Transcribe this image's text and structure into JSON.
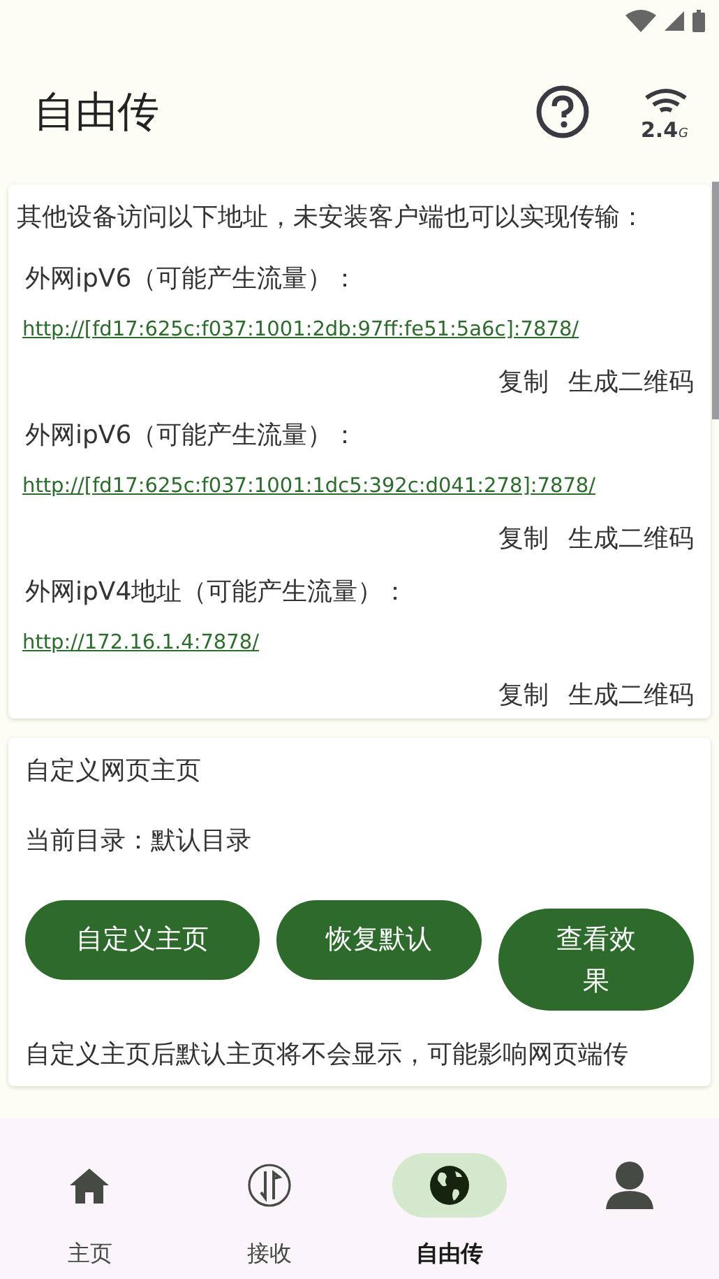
{
  "app_bar": {
    "title": "自由传",
    "band": "2.4",
    "band_unit": "G"
  },
  "address_card": {
    "intro": "其他设备访问以下地址，未安装客户端也可以实现传输：",
    "addresses": [
      {
        "label": "外网ipV6（可能产生流量）：",
        "url": "http://[fd17:625c:f037:1001:2db:97ff:fe51:5a6c]:7878/",
        "actions": [
          "复制",
          "生成二维码"
        ]
      },
      {
        "label": "外网ipV6（可能产生流量）：",
        "url": "http://[fd17:625c:f037:1001:1dc5:392c:d041:278]:7878/",
        "actions": [
          "复制",
          "生成二维码"
        ]
      },
      {
        "label": "外网ipV4地址（可能产生流量）：",
        "url": "http://172.16.1.4:7878/",
        "actions": [
          "复制",
          "生成二维码"
        ]
      }
    ]
  },
  "homepage_card": {
    "title": "自定义网页主页",
    "current_dir": "当前目录：默认目录",
    "buttons": [
      "自定义主页",
      "恢复默认",
      "查看效果"
    ],
    "note": "自定义主页后默认主页将不会显示，可能影响网页端传"
  },
  "bottom_nav": [
    {
      "kind": "home",
      "label": "主页",
      "selected": false
    },
    {
      "kind": "receive",
      "label": "接收",
      "selected": false
    },
    {
      "kind": "globe",
      "label": "自由传",
      "selected": true
    },
    {
      "kind": "person",
      "selected": false
    }
  ]
}
